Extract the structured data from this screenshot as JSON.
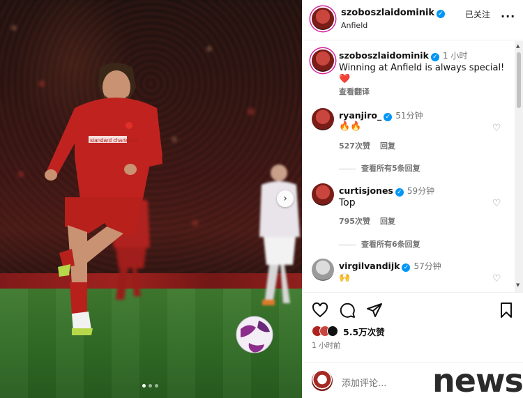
{
  "post": {
    "username": "szoboszlaidominik",
    "location": "Anfield",
    "follow_status": "已关注",
    "more_label": "...",
    "caption": {
      "username": "szoboszlaidominik",
      "time": "1 小时",
      "text": "Winning at Anfield is always special!",
      "emoji": "❤️",
      "translate": "查看翻译"
    }
  },
  "comments": [
    {
      "username": "ryanjiro_",
      "time": "51分钟",
      "text": "🔥🔥",
      "likes": "527次赞",
      "reply": "回复",
      "view_replies": "查看所有5条回复",
      "verified": true
    },
    {
      "username": "curtisjones",
      "time": "59分钟",
      "text": "Top",
      "likes": "795次赞",
      "reply": "回复",
      "view_replies": "查看所有6条回复",
      "verified": true
    },
    {
      "username": "virgilvandijk",
      "time": "57分钟",
      "text": "🙌",
      "verified": true
    }
  ],
  "actions": {
    "like_count": "5.5万次赞",
    "posted_time": "1 小时前",
    "comment_placeholder": "添加评论..."
  },
  "watermark": "news",
  "colors": {
    "verified": "#0095f6",
    "secondary_text": "#737373",
    "story_ring": "#d6249f"
  }
}
